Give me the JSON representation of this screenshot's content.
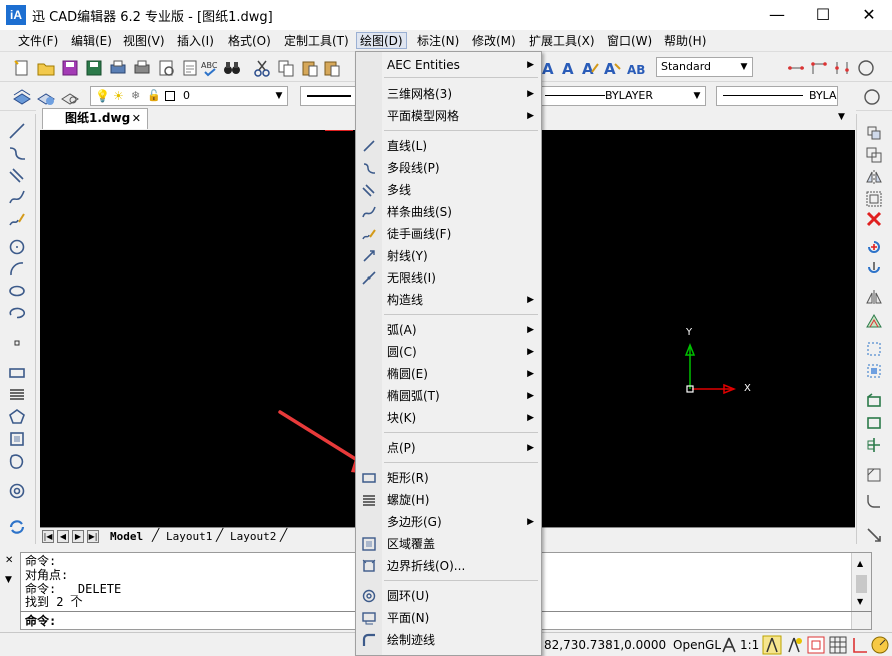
{
  "window": {
    "title": "迅    CAD编辑器 6.2 专业版  - [图纸1.dwg]",
    "app_icon": "iA",
    "minimize": "—",
    "maximize": "☐",
    "close": "✕"
  },
  "menubar": {
    "items": [
      "文件(F)",
      "编辑(E)",
      "视图(V)",
      "插入(I)",
      "格式(O)",
      "定制工具(T)",
      "绘图(D)",
      "标注(N)",
      "修改(M)",
      "扩展工具(X)",
      "窗口(W)",
      "帮助(H)"
    ],
    "active": "绘图(D)"
  },
  "toolbar": {
    "text_style": "Standard",
    "layer": "0",
    "linetype": "BYLAYER",
    "lineweight": "BYLA"
  },
  "document": {
    "tab_label": "图纸1.dwg",
    "tab_close": "✕",
    "layouts": [
      "Model",
      "Layout1",
      "Layout2"
    ]
  },
  "canvas": {
    "ucs_y": "Y",
    "ucs_x": "X"
  },
  "command": {
    "history": [
      "命令:",
      "对角点:",
      "命令:  _DELETE",
      "找到 2 个"
    ],
    "prompt": "命令:"
  },
  "statusbar": {
    "coords": "82,730.7381,0.0000",
    "opengl": "OpenGL",
    "scale": "1:1"
  },
  "draw_menu": {
    "items": [
      {
        "label": "AEC Entities",
        "sub": true
      },
      {
        "sep": true
      },
      {
        "label": "三维网格(3)",
        "sub": true
      },
      {
        "label": "平面模型网格",
        "sub": true
      },
      {
        "sep": true
      },
      {
        "label": "直线(L)",
        "icon": "line-icon"
      },
      {
        "label": "多段线(P)",
        "icon": "polyline-icon"
      },
      {
        "label": "多线",
        "icon": "multiline-icon"
      },
      {
        "label": "样条曲线(S)",
        "icon": "spline-icon"
      },
      {
        "label": "徒手画线(F)",
        "icon": "freehand-icon"
      },
      {
        "label": "射线(Y)",
        "icon": "ray-icon"
      },
      {
        "label": "无限线(I)",
        "icon": "xline-icon"
      },
      {
        "label": "构造线",
        "sub": true
      },
      {
        "sep": true
      },
      {
        "label": "弧(A)",
        "sub": true
      },
      {
        "label": "圆(C)",
        "sub": true
      },
      {
        "label": "椭圆(E)",
        "sub": true
      },
      {
        "label": "椭圆弧(T)",
        "sub": true
      },
      {
        "label": "块(K)",
        "sub": true
      },
      {
        "sep": true
      },
      {
        "label": "点(P)",
        "sub": true
      },
      {
        "sep": true
      },
      {
        "label": "矩形(R)",
        "icon": "rectangle-icon"
      },
      {
        "label": "螺旋(H)",
        "icon": "helix-icon"
      },
      {
        "label": "多边形(G)",
        "sub": true
      },
      {
        "label": "区域覆盖",
        "icon": "wipeout-icon"
      },
      {
        "label": "边界折线(O)...",
        "icon": "boundary-icon"
      },
      {
        "sep": true
      },
      {
        "label": "圆环(U)",
        "icon": "donut-icon"
      },
      {
        "label": "平面(N)",
        "icon": "plane-icon"
      },
      {
        "label": "绘制迹线",
        "icon": "trace-icon"
      }
    ]
  },
  "colors": {
    "canvas": "#000000",
    "arrow": "#e83a3a",
    "ucs_y": "#00c000",
    "ucs_x": "#e00000"
  }
}
